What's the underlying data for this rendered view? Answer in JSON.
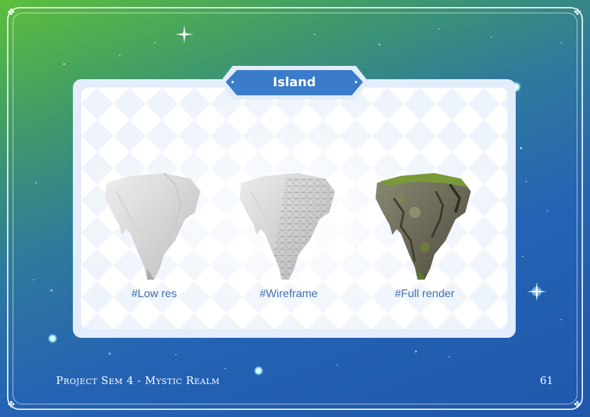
{
  "page": {
    "title": "Island",
    "footer_project": "Project Sem 4 - Mystic Realm",
    "page_number": "61"
  },
  "panels": [
    {
      "caption": "#Low res"
    },
    {
      "caption": "#Wireframe"
    },
    {
      "caption": "#Full render"
    }
  ],
  "colors": {
    "background_top": "#5cbf3c",
    "background_bottom": "#1f57ab",
    "title_tab": "#3a7cc9",
    "caption_text": "#3f6fb0",
    "card_border": "#e3edfb"
  },
  "icons": [
    "clover-icon",
    "sparkle-icon"
  ]
}
